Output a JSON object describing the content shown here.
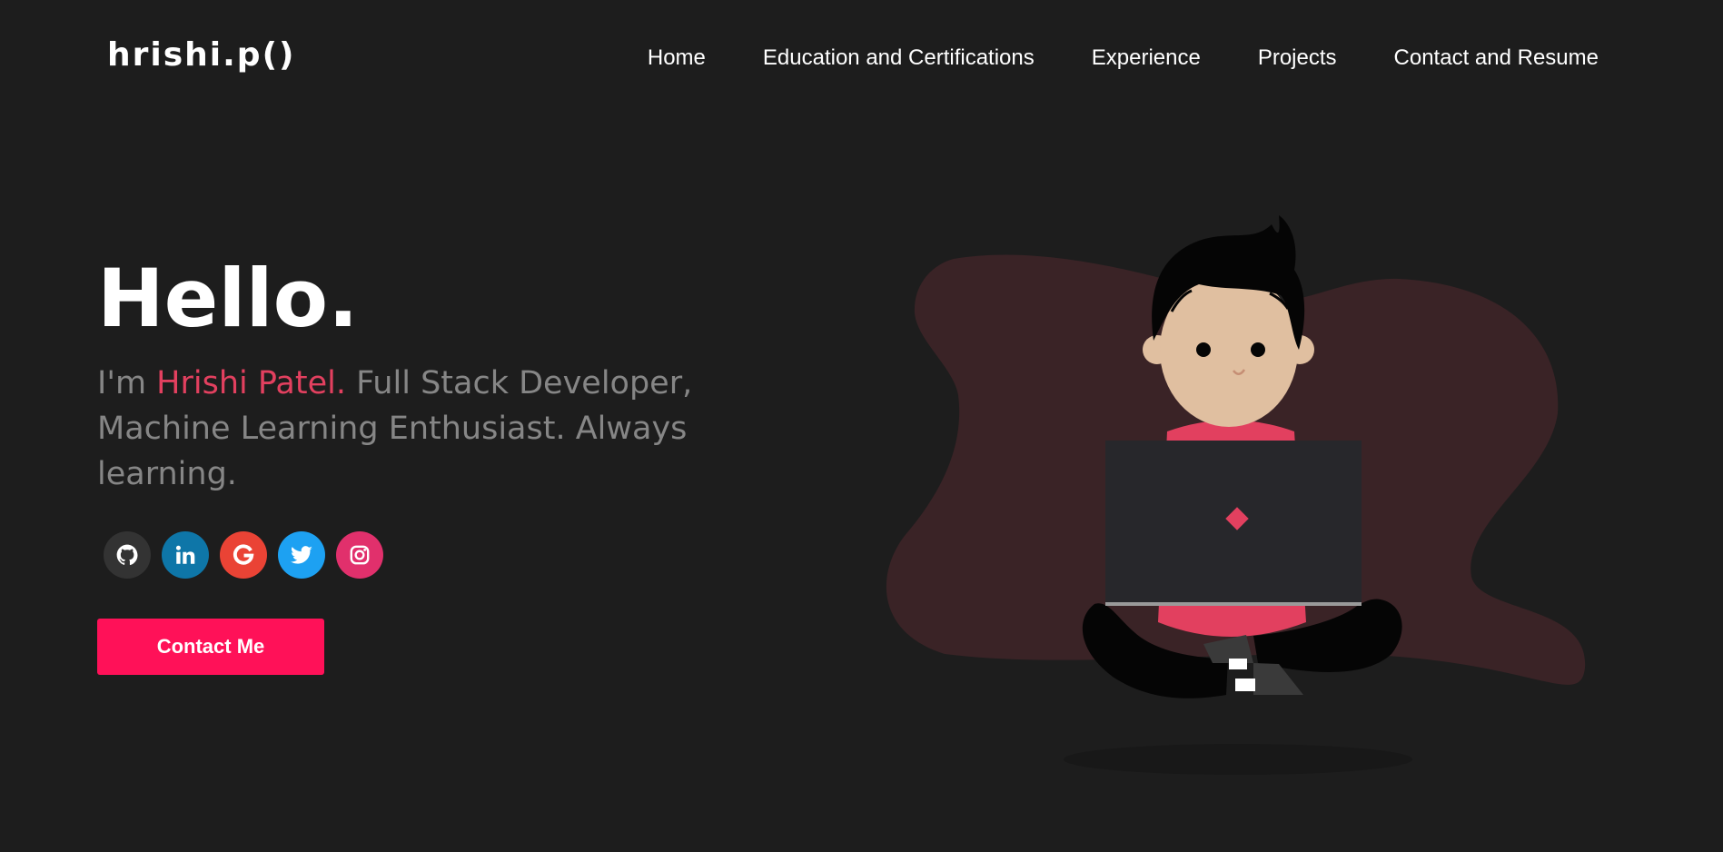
{
  "header": {
    "logo": "hrishi.p()",
    "nav": [
      {
        "label": "Home"
      },
      {
        "label": "Education and Certifications"
      },
      {
        "label": "Experience"
      },
      {
        "label": "Projects"
      },
      {
        "label": "Contact and Resume"
      }
    ]
  },
  "hero": {
    "greeting": "Hello.",
    "intro_prefix": "I'm ",
    "name": "Hrishi Patel.",
    "intro_suffix": " Full Stack Developer, Machine Learning Enthusiast. Always learning.",
    "contact_button": "Contact Me"
  },
  "socials": [
    {
      "icon": "github-icon",
      "color": "#333333"
    },
    {
      "icon": "linkedin-icon",
      "color": "#0e76a8"
    },
    {
      "icon": "google-icon",
      "color": "#ea4335"
    },
    {
      "icon": "twitter-icon",
      "color": "#1da1f2"
    },
    {
      "icon": "instagram-icon",
      "color": "#e1306c"
    }
  ],
  "colors": {
    "background": "#1d1d1d",
    "accent": "#e2405f",
    "button": "#ff1158",
    "blob": "#3a2326",
    "laptop": "#27272b"
  }
}
